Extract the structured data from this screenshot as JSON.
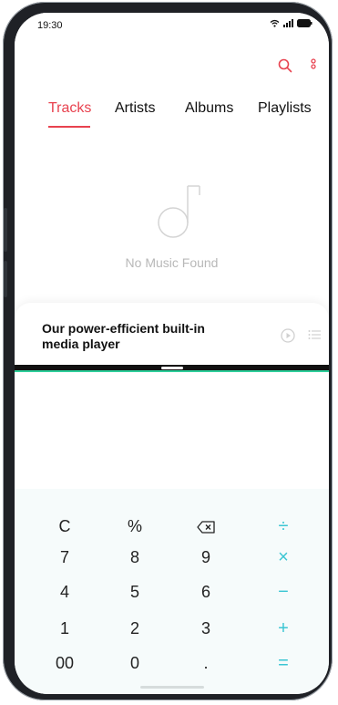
{
  "status_bar": {
    "time": "19:30",
    "icons": [
      "wifi-icon",
      "signal-icon",
      "battery-icon"
    ]
  },
  "music_app": {
    "actions": [
      "search-icon",
      "more-options-icon"
    ],
    "tabs": [
      {
        "label": "Tracks",
        "active": true
      },
      {
        "label": "Artists",
        "active": false
      },
      {
        "label": "Albums",
        "active": false
      },
      {
        "label": "Playlists",
        "active": false
      }
    ],
    "empty_state": {
      "icon": "music-note-icon",
      "text": "No Music Found"
    },
    "mini_player": {
      "title_line1": "Our power-efficient built-in",
      "title_line2": "media player",
      "controls": [
        "play-icon",
        "playlist-icon"
      ]
    }
  },
  "calculator": {
    "keys": [
      [
        "C",
        "%",
        "backspace",
        "÷"
      ],
      [
        "7",
        "8",
        "9",
        "×"
      ],
      [
        "4",
        "5",
        "6",
        "−"
      ],
      [
        "1",
        "2",
        "3",
        "+"
      ],
      [
        "00",
        "0",
        ".",
        "="
      ]
    ]
  },
  "colors": {
    "accent_red": "#e8424f",
    "calc_operator": "#3cc6d3",
    "divider_green": "#2ecf9a",
    "empty_text": "#b8b8b8"
  }
}
